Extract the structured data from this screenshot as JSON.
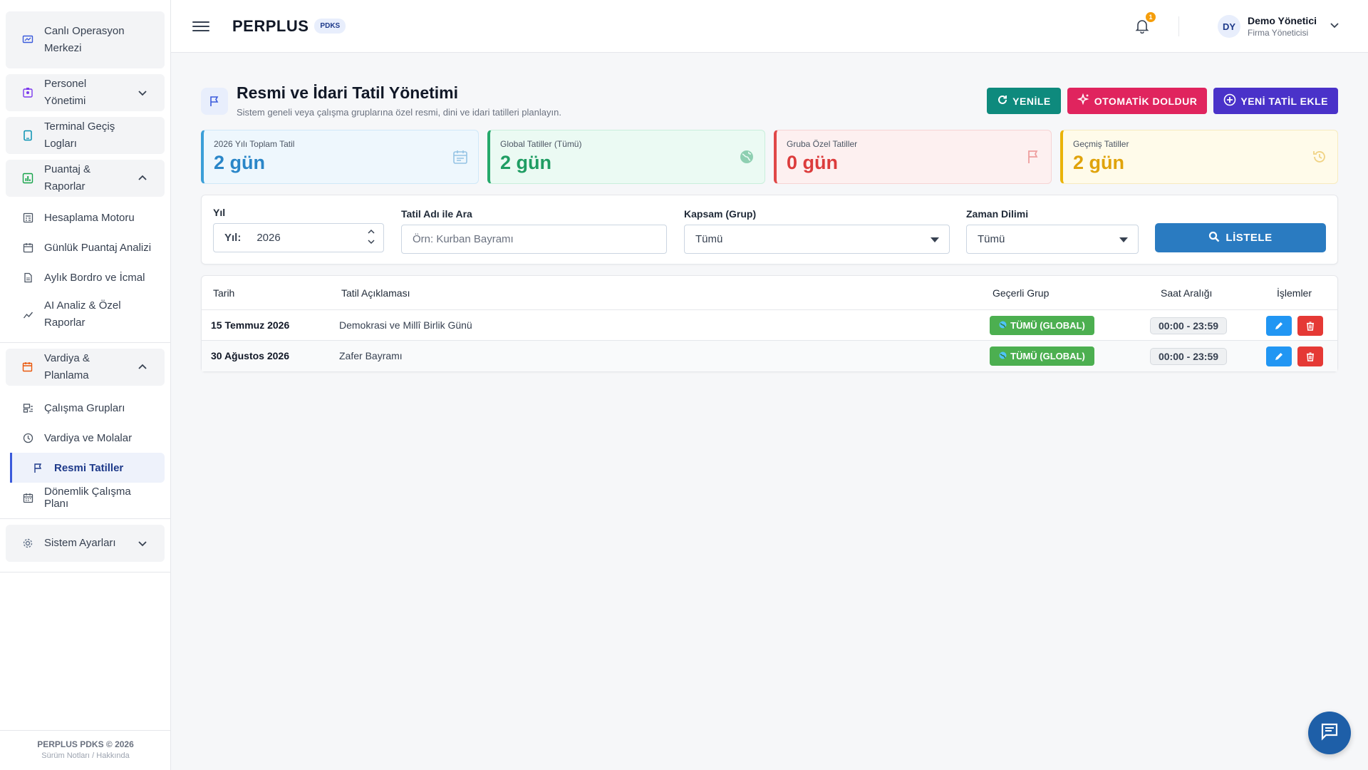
{
  "sidebar": {
    "items": [
      {
        "label": "Canlı Operasyon Merkezi"
      },
      {
        "label": "Personel Yönetimi"
      },
      {
        "label": "Terminal Geçiş Logları"
      },
      {
        "label": "Puantaj & Raporlar"
      },
      {
        "label": "Vardiya & Planlama"
      },
      {
        "label": "Sistem Ayarları"
      }
    ],
    "puantaj_sub": [
      {
        "label": "Hesaplama Motoru"
      },
      {
        "label": "Günlük Puantaj Analizi"
      },
      {
        "label": "Aylık Bordro ve İcmal"
      },
      {
        "label": "AI Analiz & Özel Raporlar"
      }
    ],
    "vardiya_sub": [
      {
        "label": "Çalışma Grupları"
      },
      {
        "label": "Vardiya ve Molalar"
      },
      {
        "label": "Resmi Tatiller"
      },
      {
        "label": "Dönemlik Çalışma Planı"
      }
    ],
    "footer": {
      "line1": "PERPLUS PDKS © 2026",
      "line2": "Sürüm Notları / Hakkında"
    }
  },
  "topbar": {
    "brand": "PERPLUS",
    "badge": "PDKS",
    "notification_count": "1",
    "user": {
      "initials": "DY",
      "name": "Demo Yönetici",
      "role": "Firma Yöneticisi"
    }
  },
  "page": {
    "title": "Resmi ve İdari Tatil Yönetimi",
    "subtitle": "Sistem geneli veya çalışma gruplarına özel resmi, dini ve idari tatilleri planlayın.",
    "buttons": {
      "refresh": "YENİLE",
      "autofill": "OTOMATİK DOLDUR",
      "add": "YENİ TATİL EKLE"
    }
  },
  "stats": [
    {
      "label": "2026 Yılı Toplam Tatil",
      "value": "2 gün"
    },
    {
      "label": "Global Tatiller (Tümü)",
      "value": "2 gün"
    },
    {
      "label": "Gruba Özel Tatiller",
      "value": "0 gün"
    },
    {
      "label": "Geçmiş Tatiller",
      "value": "2 gün"
    }
  ],
  "filters": {
    "year_label": "Yıl",
    "year_inline": "Yıl:",
    "year_value": "2026",
    "search_label": "Tatil Adı ile Ara",
    "search_placeholder": "Örn: Kurban Bayramı",
    "scope_label": "Kapsam (Grup)",
    "scope_value": "Tümü",
    "time_label": "Zaman Dilimi",
    "time_value": "Tümü",
    "list_button": "LİSTELE"
  },
  "table": {
    "headers": {
      "date": "Tarih",
      "desc": "Tatil Açıklaması",
      "group": "Geçerli Grup",
      "time": "Saat Aralığı",
      "actions": "İşlemler"
    },
    "rows": [
      {
        "date": "15 Temmuz 2026",
        "desc": "Demokrasi ve Millî Birlik Günü",
        "group": "TÜMÜ (GLOBAL)",
        "time": "00:00 - 23:59"
      },
      {
        "date": "30 Ağustos 2026",
        "desc": "Zafer Bayramı",
        "group": "TÜMÜ (GLOBAL)",
        "time": "00:00 - 23:59"
      }
    ]
  },
  "colors": {
    "accent": "#3b5bdb",
    "teal": "#0e8a7d",
    "pink": "#e0245e",
    "indigo": "#4a32c9",
    "list": "#2a7bc1",
    "global_badge": "#4caf50"
  }
}
